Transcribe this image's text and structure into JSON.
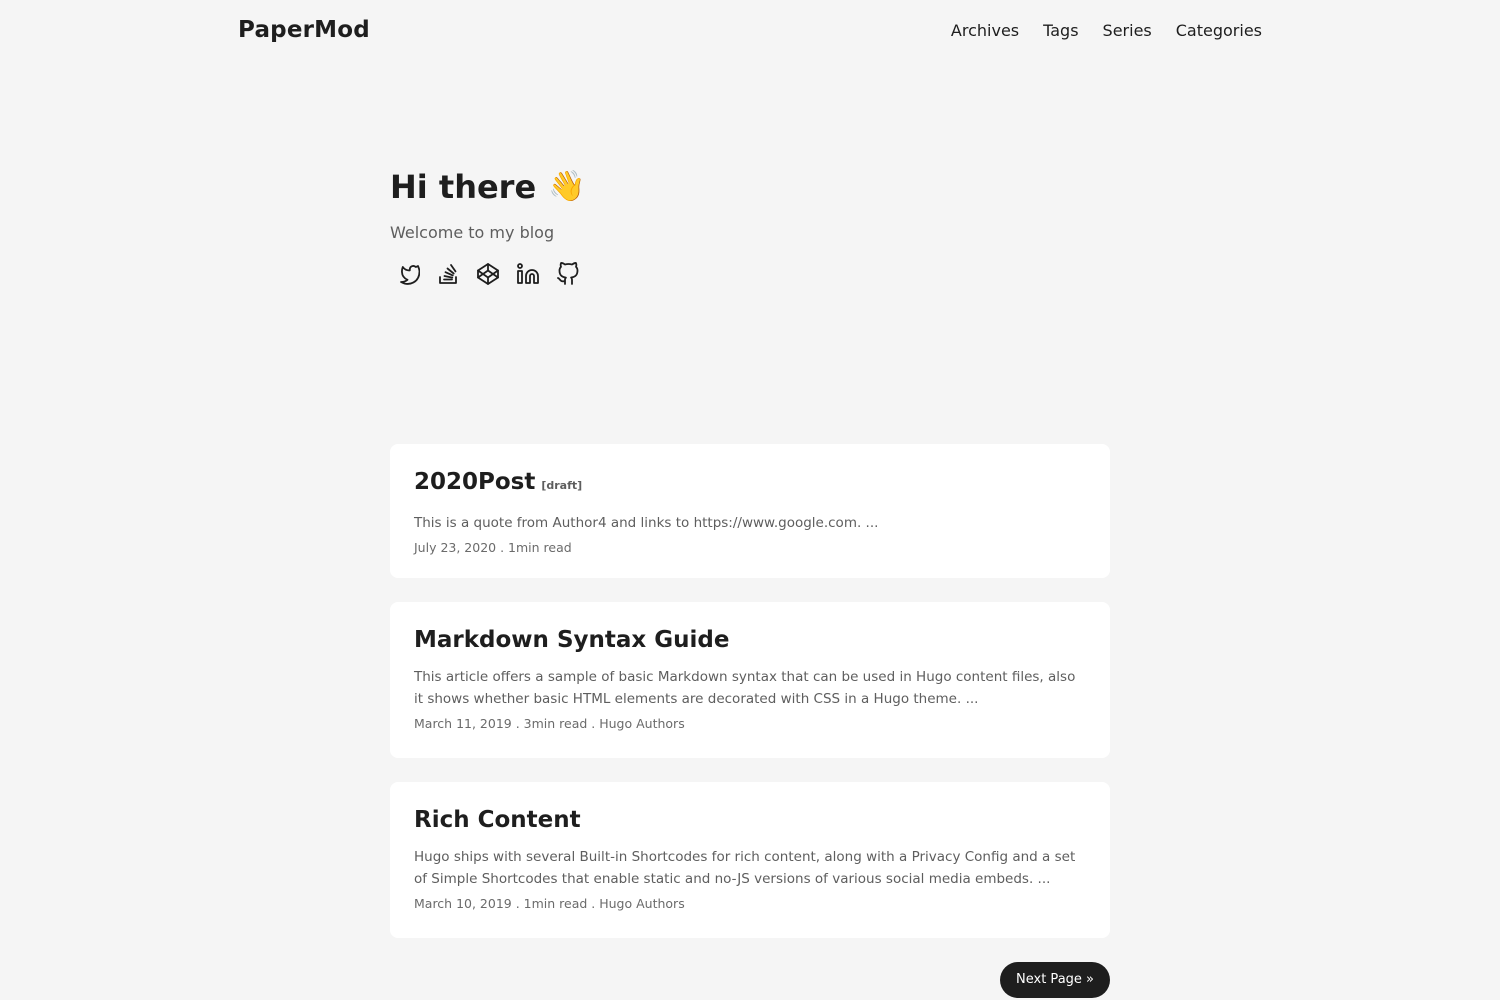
{
  "header": {
    "logo": "PaperMod",
    "menu": [
      {
        "label": "Archives"
      },
      {
        "label": "Tags"
      },
      {
        "label": "Series"
      },
      {
        "label": "Categories"
      }
    ]
  },
  "home": {
    "title": "Hi there",
    "emoji": "👋",
    "subtitle": "Welcome to my blog",
    "social": [
      {
        "icon": "twitter-icon"
      },
      {
        "icon": "stackoverflow-icon"
      },
      {
        "icon": "codepen-icon"
      },
      {
        "icon": "linkedin-icon"
      },
      {
        "icon": "github-icon"
      }
    ]
  },
  "posts": [
    {
      "title": "2020Post",
      "draft": "[draft]",
      "summary": "This is a quote from Author4 and links to https://www.google.com. ...",
      "meta": "July 23, 2020 . 1min read"
    },
    {
      "title": "Markdown Syntax Guide",
      "draft": "",
      "summary": "This article offers a sample of basic Markdown syntax that can be used in Hugo content files, also it shows whether basic HTML elements are decorated with CSS in a Hugo theme. ...",
      "meta": "March 11, 2019 . 3min read . Hugo Authors"
    },
    {
      "title": "Rich Content",
      "draft": "",
      "summary": "Hugo ships with several Built-in Shortcodes for rich content, along with a Privacy Config and a set of Simple Shortcodes that enable static and no-JS versions of various social media embeds. ...",
      "meta": "March 10, 2019 . 1min read . Hugo Authors"
    }
  ],
  "pagination": {
    "next_label": "Next Page »"
  },
  "colors": {
    "background": "#f5f5f5",
    "card": "#ffffff",
    "text": "#1e1e1e",
    "secondary": "#5e5e5e",
    "button": "#1e1e1e"
  }
}
